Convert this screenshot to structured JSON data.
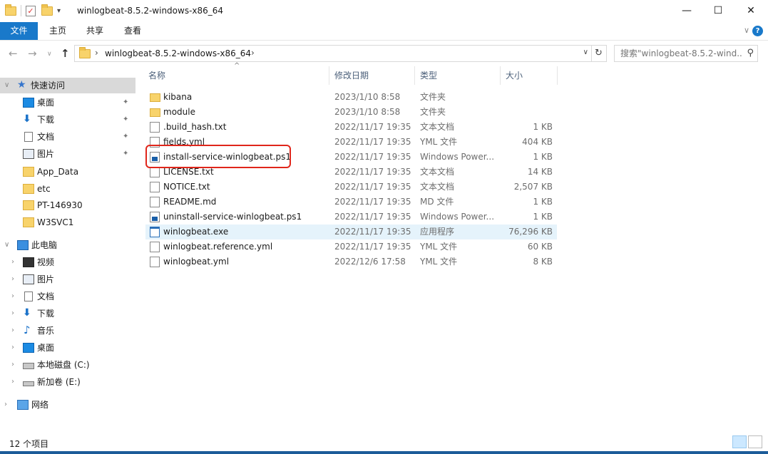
{
  "window": {
    "title": "winlogbeat-8.5.2-windows-x86_64",
    "qat_dropdown": "▾",
    "minimize": "—",
    "maximize": "☐",
    "close": "✕"
  },
  "ribbon": {
    "tabs": [
      "文件",
      "主页",
      "共享",
      "查看"
    ],
    "collapse": "∨",
    "help": "?"
  },
  "nav": {
    "back": "←",
    "forward": "→",
    "recent": "∨",
    "up": "↑",
    "chevron": "›",
    "path": "winlogbeat-8.5.2-windows-x86_64",
    "dropdown": "∨",
    "refresh": "↻",
    "search_placeholder": "搜索\"winlogbeat-8.5.2-wind...",
    "search_icon": "⚲"
  },
  "sidebar": {
    "items": [
      {
        "label": "快速访问",
        "icon": "star-icon",
        "arrow": "∨",
        "selected": true
      },
      {
        "label": "桌面",
        "icon": "desktop-icon",
        "pinned": true
      },
      {
        "label": "下载",
        "icon": "download-icon",
        "pinned": true
      },
      {
        "label": "文档",
        "icon": "document-icon",
        "pinned": true
      },
      {
        "label": "图片",
        "icon": "pictures-icon",
        "pinned": true
      },
      {
        "label": "App_Data",
        "icon": "folder-icon"
      },
      {
        "label": "etc",
        "icon": "folder-icon"
      },
      {
        "label": "PT-146930",
        "icon": "folder-icon"
      },
      {
        "label": "W3SVC1",
        "icon": "folder-icon"
      },
      {
        "label": "此电脑",
        "icon": "computer-icon",
        "arrow": "∨"
      },
      {
        "label": "视频",
        "icon": "video-icon",
        "arrow": "›"
      },
      {
        "label": "图片",
        "icon": "pictures-icon",
        "arrow": "›"
      },
      {
        "label": "文档",
        "icon": "document-icon",
        "arrow": "›"
      },
      {
        "label": "下载",
        "icon": "download-icon",
        "arrow": "›"
      },
      {
        "label": "音乐",
        "icon": "music-icon",
        "arrow": "›"
      },
      {
        "label": "桌面",
        "icon": "desktop-icon",
        "arrow": "›"
      },
      {
        "label": "本地磁盘 (C:)",
        "icon": "drive-icon",
        "arrow": "›"
      },
      {
        "label": "新加卷 (E:)",
        "icon": "drive-icon",
        "arrow": "›"
      },
      {
        "label": "网络",
        "icon": "network-icon",
        "arrow": "›"
      }
    ],
    "pin_glyph": "📌"
  },
  "columns": {
    "name": "名称",
    "date": "修改日期",
    "type": "类型",
    "size": "大小",
    "sort_caret": "^"
  },
  "files": [
    {
      "name": "kibana",
      "date": "2023/1/10 8:58",
      "type": "文件夹",
      "size": "",
      "icon": "folder-icon"
    },
    {
      "name": "module",
      "date": "2023/1/10 8:58",
      "type": "文件夹",
      "size": "",
      "icon": "folder-icon"
    },
    {
      "name": ".build_hash.txt",
      "date": "2022/11/17 19:35",
      "type": "文本文档",
      "size": "1 KB",
      "icon": "text-file-icon"
    },
    {
      "name": "fields.yml",
      "date": "2022/11/17 19:35",
      "type": "YML 文件",
      "size": "404 KB",
      "icon": "file-icon"
    },
    {
      "name": "install-service-winlogbeat.ps1",
      "date": "2022/11/17 19:35",
      "type": "Windows Power...",
      "size": "1 KB",
      "icon": "powershell-script-icon"
    },
    {
      "name": "LICENSE.txt",
      "date": "2022/11/17 19:35",
      "type": "文本文档",
      "size": "14 KB",
      "icon": "text-file-icon"
    },
    {
      "name": "NOTICE.txt",
      "date": "2022/11/17 19:35",
      "type": "文本文档",
      "size": "2,507 KB",
      "icon": "text-file-icon"
    },
    {
      "name": "README.md",
      "date": "2022/11/17 19:35",
      "type": "MD 文件",
      "size": "1 KB",
      "icon": "file-icon"
    },
    {
      "name": "uninstall-service-winlogbeat.ps1",
      "date": "2022/11/17 19:35",
      "type": "Windows Power...",
      "size": "1 KB",
      "icon": "powershell-script-icon"
    },
    {
      "name": "winlogbeat.exe",
      "date": "2022/11/17 19:35",
      "type": "应用程序",
      "size": "76,296 KB",
      "icon": "application-icon",
      "selected": true
    },
    {
      "name": "winlogbeat.reference.yml",
      "date": "2022/11/17 19:35",
      "type": "YML 文件",
      "size": "60 KB",
      "icon": "file-icon"
    },
    {
      "name": "winlogbeat.yml",
      "date": "2022/12/6 17:58",
      "type": "YML 文件",
      "size": "8 KB",
      "icon": "file-icon"
    }
  ],
  "status": {
    "count": "12 个项目"
  },
  "colors": {
    "accent": "#1979ca",
    "highlight_box": "#e0261b",
    "selection": "#e5f3fb"
  }
}
